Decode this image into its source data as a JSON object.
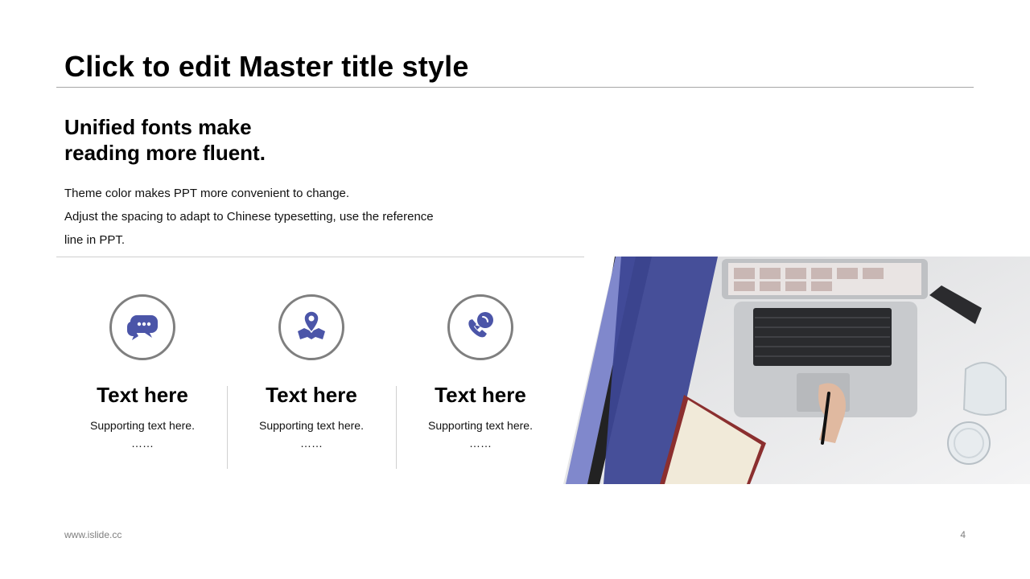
{
  "slide": {
    "title": "Click to edit Master title style",
    "subtitle_line1": "Unified fonts make",
    "subtitle_line2": "reading more fluent.",
    "body_line1": "Theme color makes PPT more convenient to change.",
    "body_line2": "Adjust the spacing to adapt to Chinese typesetting, use the reference",
    "body_line3": "line in PPT."
  },
  "features": [
    {
      "icon": "chat-bubbles-icon",
      "title": "Text here",
      "subtitle": "Supporting text here.",
      "dots": "……"
    },
    {
      "icon": "map-pin-icon",
      "title": "Text here",
      "subtitle": "Supporting text here.",
      "dots": "……"
    },
    {
      "icon": "phone-call-icon",
      "title": "Text here",
      "subtitle": "Supporting text here.",
      "dots": "……"
    }
  ],
  "footer": {
    "url": "www.islide.cc",
    "page_number": "4"
  },
  "colors": {
    "accent": "#4b55a8",
    "accent_light": "#8088cc",
    "circle_border": "#7f7f7f",
    "rule": "#a6a6a6"
  }
}
